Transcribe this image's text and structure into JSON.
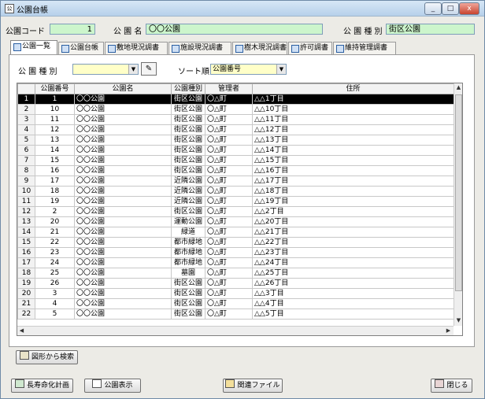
{
  "window": {
    "title": "公園台帳",
    "minimize": "_",
    "maximize": "□",
    "close": "x"
  },
  "header": {
    "park_code_label": "公園コード",
    "park_code_value": "1",
    "park_name_label": "公 園 名",
    "park_name_value": "〇〇公園",
    "park_type_label": "公 園 種 別",
    "park_type_value": "街区公園"
  },
  "tabs": [
    {
      "label": "公園一覧"
    },
    {
      "label": "公園台帳"
    },
    {
      "label": "敷地現況調書"
    },
    {
      "label": "施設現況調書"
    },
    {
      "label": "樹木現況調書"
    },
    {
      "label": "許可調書"
    },
    {
      "label": "維持管理調書"
    }
  ],
  "filters": {
    "park_type_label": "公 園 種 別",
    "park_type_value": "",
    "sort_label": "ソート順",
    "sort_value": "公園番号"
  },
  "grid": {
    "columns": [
      "",
      "公園番号",
      "公園名",
      "公園種別",
      "管理者",
      "住所"
    ],
    "rows": [
      [
        "1",
        "1",
        "〇〇公園",
        "街区公園",
        "〇△町",
        "△△1丁目"
      ],
      [
        "2",
        "10",
        "〇〇公園",
        "街区公園",
        "〇△町",
        "△△10丁目"
      ],
      [
        "3",
        "11",
        "〇〇公園",
        "街区公園",
        "〇△町",
        "△△11丁目"
      ],
      [
        "4",
        "12",
        "〇〇公園",
        "街区公園",
        "〇△町",
        "△△12丁目"
      ],
      [
        "5",
        "13",
        "〇〇公園",
        "街区公園",
        "〇△町",
        "△△13丁目"
      ],
      [
        "6",
        "14",
        "〇〇公園",
        "街区公園",
        "〇△町",
        "△△14丁目"
      ],
      [
        "7",
        "15",
        "〇〇公園",
        "街区公園",
        "〇△町",
        "△△15丁目"
      ],
      [
        "8",
        "16",
        "〇〇公園",
        "街区公園",
        "〇△町",
        "△△16丁目"
      ],
      [
        "9",
        "17",
        "〇〇公園",
        "近隣公園",
        "〇△町",
        "△△17丁目"
      ],
      [
        "10",
        "18",
        "〇〇公園",
        "近隣公園",
        "〇△町",
        "△△18丁目"
      ],
      [
        "11",
        "19",
        "〇〇公園",
        "近隣公園",
        "〇△町",
        "△△19丁目"
      ],
      [
        "12",
        "2",
        "〇〇公園",
        "街区公園",
        "〇△町",
        "△△2丁目"
      ],
      [
        "13",
        "20",
        "〇〇公園",
        "運動公園",
        "〇△町",
        "△△20丁目"
      ],
      [
        "14",
        "21",
        "〇〇公園",
        "緑道",
        "〇△町",
        "△△21丁目"
      ],
      [
        "15",
        "22",
        "〇〇公園",
        "都市緑地",
        "〇△町",
        "△△22丁目"
      ],
      [
        "16",
        "23",
        "〇〇公園",
        "都市緑地",
        "〇△町",
        "△△23丁目"
      ],
      [
        "17",
        "24",
        "〇〇公園",
        "都市緑地",
        "〇△町",
        "△△24丁目"
      ],
      [
        "18",
        "25",
        "〇〇公園",
        "墓園",
        "〇△町",
        "△△25丁目"
      ],
      [
        "19",
        "26",
        "〇〇公園",
        "街区公園",
        "〇△町",
        "△△26丁目"
      ],
      [
        "20",
        "3",
        "〇〇公園",
        "街区公園",
        "〇△町",
        "△△3丁目"
      ],
      [
        "21",
        "4",
        "〇〇公園",
        "街区公園",
        "〇△町",
        "△△4丁目"
      ],
      [
        "22",
        "5",
        "〇〇公園",
        "街区公園",
        "〇△町",
        "△△5丁目"
      ]
    ]
  },
  "buttons": {
    "map_search": "図形から検索",
    "longevity_plan": "長寿命化計画",
    "park_display": "公園表示",
    "related_files": "関連ファイル",
    "close": "閉じる"
  }
}
